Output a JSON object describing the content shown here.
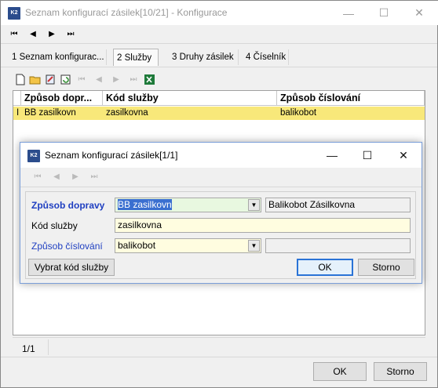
{
  "window": {
    "title": "Seznam konfigurací zásilek[10/21] - Konfigurace",
    "app_icon": "K2",
    "controls": {
      "minimize": "—",
      "maximize": "☐",
      "close": "✕"
    }
  },
  "nav_toolbar": [
    "⏮",
    "◀",
    "▶",
    "⏭"
  ],
  "tabs": [
    {
      "label": "1 Seznam konfigurac..."
    },
    {
      "label": "2 Služby"
    },
    {
      "label": "3 Druhy zásilek"
    },
    {
      "label": "4 Číselník"
    }
  ],
  "grid": {
    "columns": [
      "Způsob dopr...",
      "Kód služby",
      "Způsob číslování"
    ],
    "rows": [
      {
        "marker": "I",
        "cells": [
          "BB zasilkovn",
          "zasilkovna",
          "balikobot"
        ]
      }
    ]
  },
  "status": {
    "counter": "1/1"
  },
  "footer": {
    "ok": "OK",
    "cancel": "Storno"
  },
  "dialog": {
    "title": "Seznam konfigurací zásilek[1/1]",
    "app_icon": "K2",
    "controls": {
      "minimize": "—",
      "maximize": "☐",
      "close": "✕"
    },
    "fields": {
      "zpusob_dopravy": {
        "label": "Způsob dopravy",
        "value": "BB zasilkovn",
        "description": "Balikobot Zásilkovna"
      },
      "kod_sluzby": {
        "label": "Kód služby",
        "value": "zasilkovna"
      },
      "zpusob_cislovani": {
        "label": "Způsob číslování",
        "value": "balikobot",
        "description": ""
      }
    },
    "buttons": {
      "select_service": "Vybrat kód služby",
      "ok": "OK",
      "cancel": "Storno"
    }
  }
}
